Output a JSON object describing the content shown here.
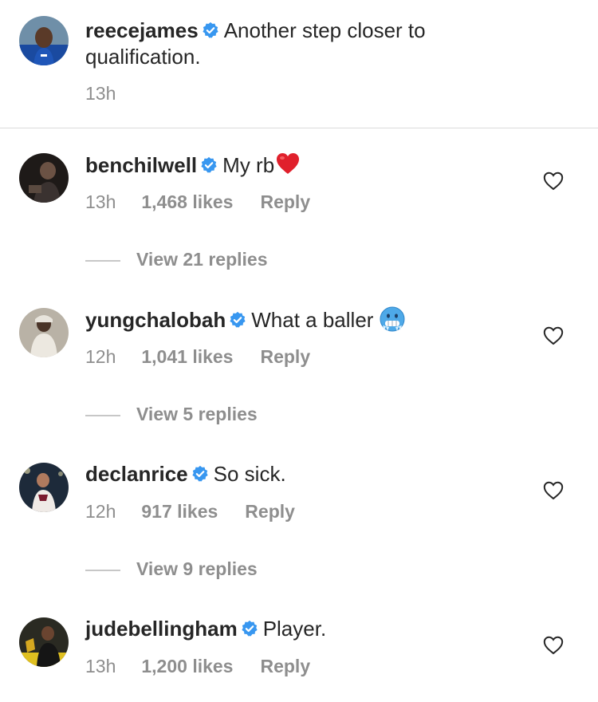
{
  "caption": {
    "username": "reecejames",
    "text": "Another step closer to qualification.",
    "time": "13h",
    "avatar_icon": "avatar-reecejames"
  },
  "comments": [
    {
      "username": "benchilwell",
      "text": "My rb",
      "emoji": "red-heart-emoji",
      "time": "13h",
      "likes": "1,468 likes",
      "reply": "Reply",
      "view_replies": "View 21 replies"
    },
    {
      "username": "yungchalobah",
      "text": "What a baller",
      "emoji": "cold-face-emoji",
      "time": "12h",
      "likes": "1,041 likes",
      "reply": "Reply",
      "view_replies": "View 5 replies"
    },
    {
      "username": "declanrice",
      "text": "So sick.",
      "time": "12h",
      "likes": "917 likes",
      "reply": "Reply",
      "view_replies": "View 9 replies"
    },
    {
      "username": "judebellingham",
      "text": "Player.",
      "time": "13h",
      "likes": "1,200 likes",
      "reply": "Reply"
    }
  ],
  "colors": {
    "text": "#262626",
    "secondary": "#8e8e8e",
    "verified": "#3897f0",
    "divider": "#dbdbdb"
  },
  "icons": {
    "verified": "verified-badge-icon",
    "like": "heart-outline-icon"
  }
}
